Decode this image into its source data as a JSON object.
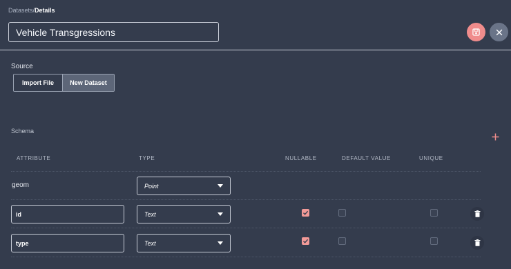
{
  "breadcrumb": {
    "parent": "Datasets",
    "separator": "/",
    "current": "Details"
  },
  "dataset": {
    "name": "Vehicle Transgressions"
  },
  "actions": {
    "save_icon": "save-icon",
    "close_icon": "close-icon"
  },
  "source": {
    "label": "Source",
    "options": [
      {
        "label": "Import File",
        "selected": false
      },
      {
        "label": "New Dataset",
        "selected": true
      }
    ]
  },
  "schema": {
    "label": "Schema",
    "columns": {
      "attribute": "ATTRIBUTE",
      "type": "TYPE",
      "nullable": "NULLABLE",
      "default_value": "DEFAULT VALUE",
      "unique": "UNIQUE"
    },
    "rows": [
      {
        "attribute": "geom",
        "type": "Point",
        "editable": false
      },
      {
        "attribute": "id",
        "type": "Text",
        "nullable": true,
        "default_value": false,
        "unique": false,
        "editable": true
      },
      {
        "attribute": "type",
        "type": "Text",
        "nullable": true,
        "default_value": false,
        "unique": false,
        "editable": true
      }
    ]
  },
  "colors": {
    "background": "#343c4d",
    "accent": "#f08c8c",
    "secondary": "#6a7488"
  }
}
